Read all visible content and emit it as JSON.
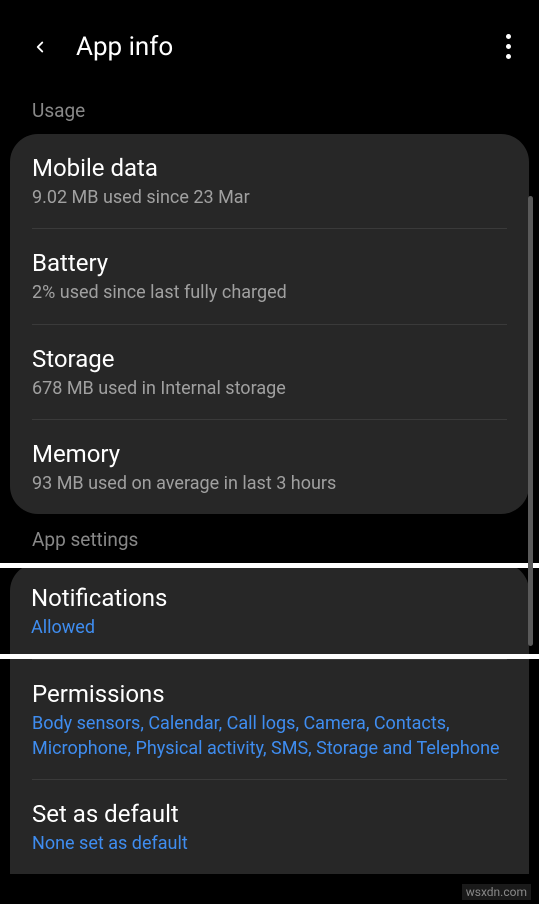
{
  "header": {
    "title": "App info"
  },
  "sections": {
    "usage": {
      "label": "Usage",
      "items": [
        {
          "title": "Mobile data",
          "subtitle": "9.02 MB used since 23 Mar"
        },
        {
          "title": "Battery",
          "subtitle": "2% used since last fully charged"
        },
        {
          "title": "Storage",
          "subtitle": "678 MB used in Internal storage"
        },
        {
          "title": "Memory",
          "subtitle": "93 MB used on average in last 3 hours"
        }
      ]
    },
    "app_settings": {
      "label": "App settings",
      "items": [
        {
          "title": "Notifications",
          "subtitle": "Allowed"
        },
        {
          "title": "Permissions",
          "subtitle": "Body sensors, Calendar, Call logs, Camera, Contacts, Microphone, Physical activity, SMS, Storage and Telephone"
        },
        {
          "title": "Set as default",
          "subtitle": "None set as default"
        }
      ]
    }
  },
  "watermark": "wsxdn.com"
}
